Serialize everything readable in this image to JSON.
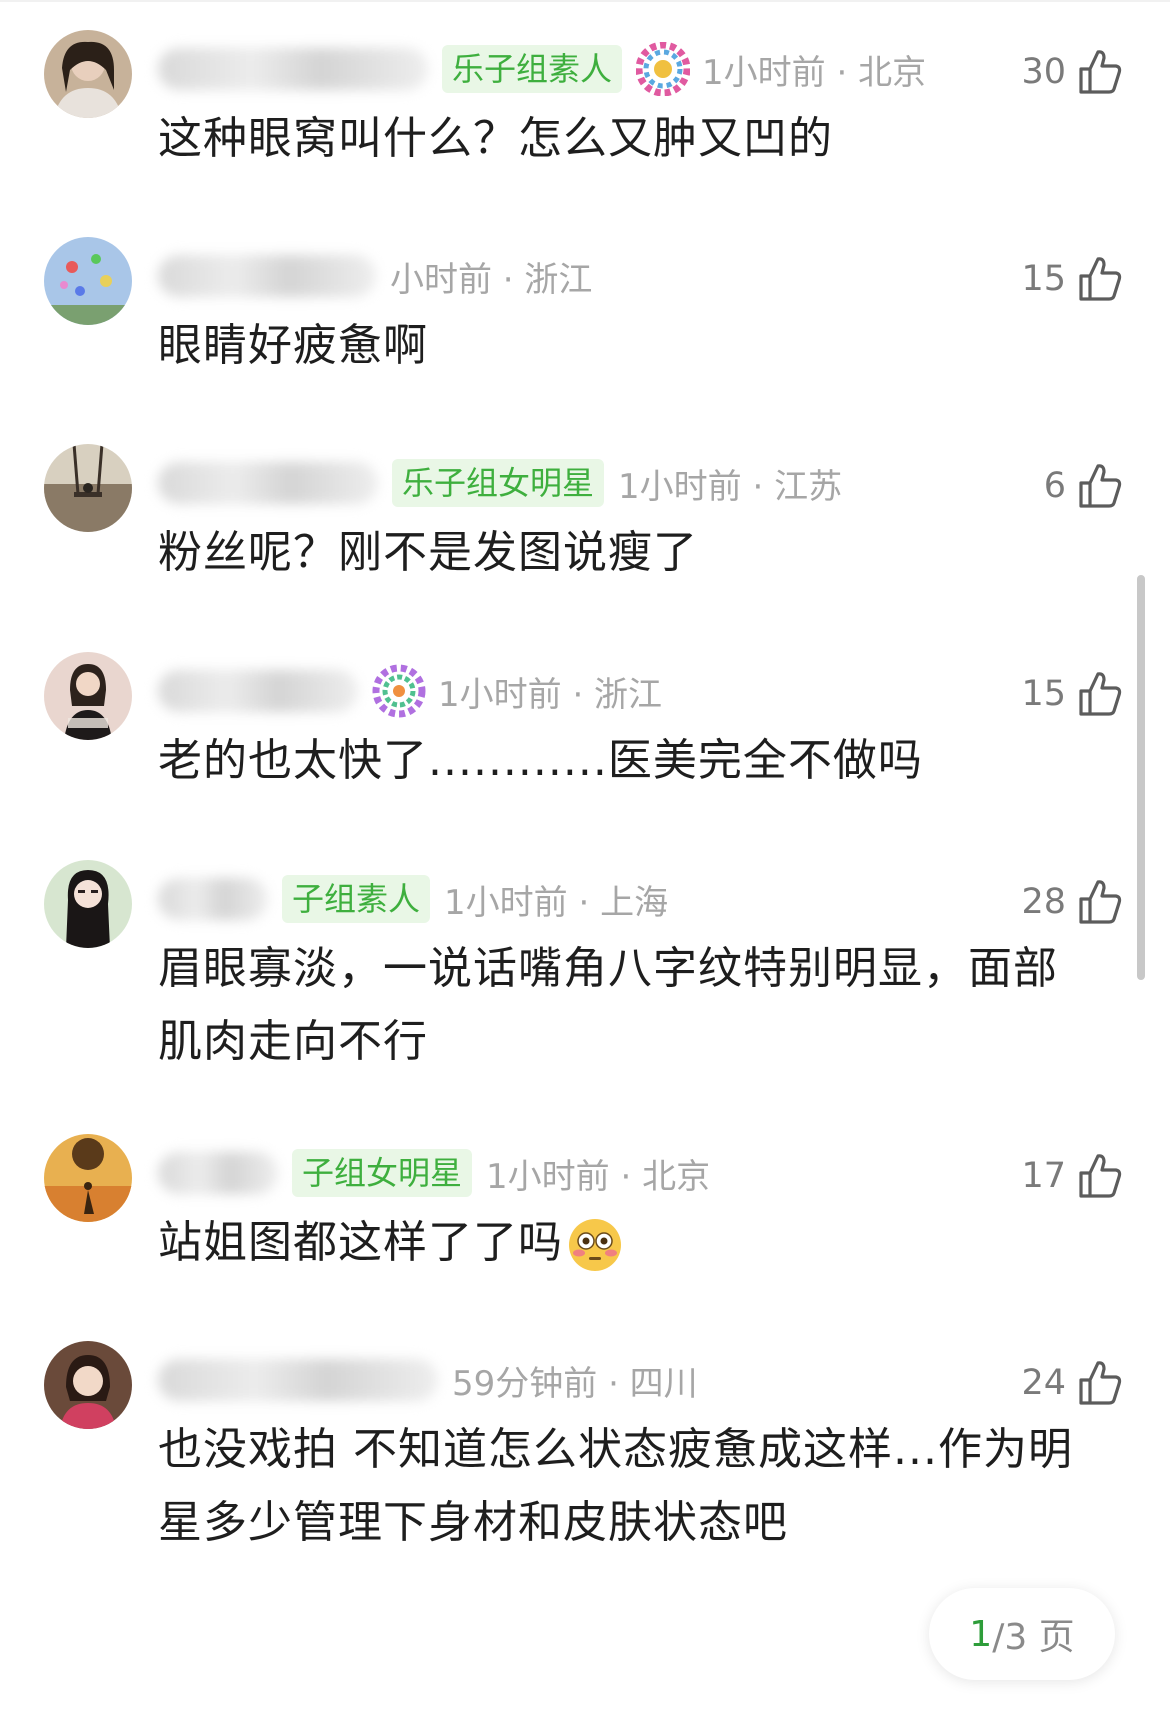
{
  "comments": [
    {
      "badge": "乐子组素人",
      "time_loc": "1小时前 · 北京",
      "likes": "30",
      "text": "这种眼窝叫什么？怎么又肿又凹的",
      "emoji": ""
    },
    {
      "badge": "",
      "time_loc": "小时前 · 浙江",
      "likes": "15",
      "text": "眼睛好疲惫啊",
      "emoji": ""
    },
    {
      "badge": "乐子组女明星",
      "time_loc": "1小时前 · 江苏",
      "likes": "6",
      "text": "粉丝呢？刚不是发图说瘦了",
      "emoji": ""
    },
    {
      "badge": "",
      "time_loc": "1小时前 · 浙江",
      "likes": "15",
      "text": "老的也太快了............医美完全不做吗",
      "emoji": ""
    },
    {
      "badge": "子组素人",
      "time_loc": "1小时前 · 上海",
      "likes": "28",
      "text": "眉眼寡淡，一说话嘴角八字纹特别明显，面部肌肉走向不行",
      "emoji": ""
    },
    {
      "badge": "子组女明星",
      "time_loc": "1小时前 · 北京",
      "likes": "17",
      "text": "站姐图都这样了了吗",
      "emoji": "flushed-face-emoji"
    },
    {
      "badge": "",
      "time_loc": "59分钟前 · 四川",
      "likes": "24",
      "text": "也没戏拍 不知道怎么状态疲惫成这样...作为明星多少管理下身材和皮肤状态吧",
      "emoji": ""
    }
  ],
  "pager": {
    "current": "1",
    "total": "/3 页"
  },
  "colors": {
    "badge_text": "#3eaf3e",
    "badge_bg": "#e9f7e6",
    "meta": "#a6a6a6",
    "pager_current": "#2e9d3a"
  },
  "icons": {
    "like": "thumbs-up-icon"
  }
}
